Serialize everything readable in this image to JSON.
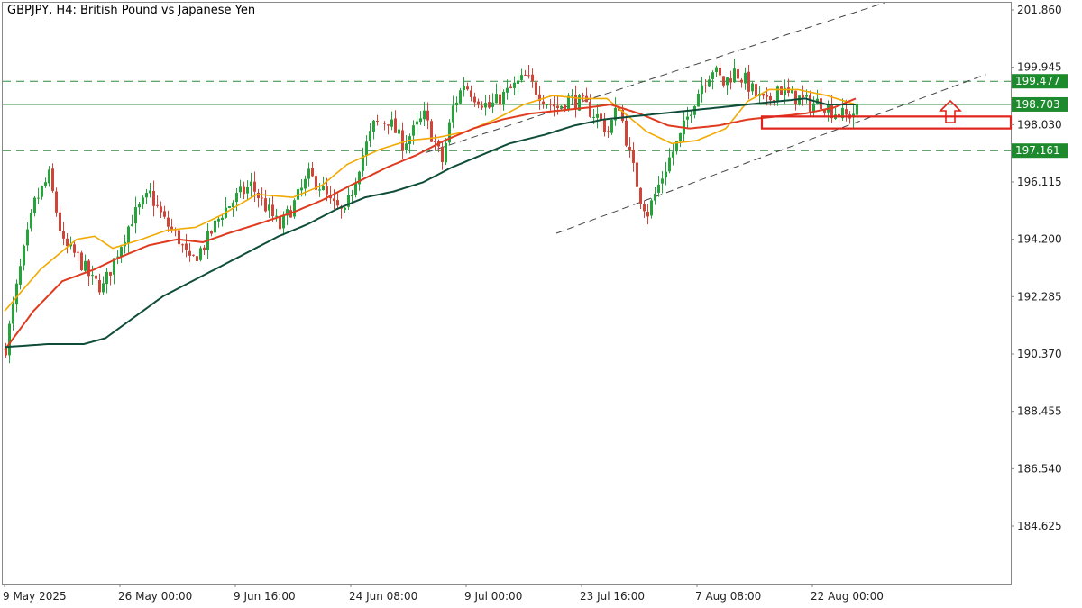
{
  "chart_title": "GBPJPY, H4:  British Pound vs Japanese Yen",
  "chart_data": {
    "type": "candlestick",
    "symbol": "GBPJPY",
    "timeframe": "H4",
    "title": "GBPJPY, H4:  British Pound vs Japanese Yen",
    "ylim": [
      182.7,
      202.1
    ],
    "y_ticks": [
      "201.860",
      "199.945",
      "198.030",
      "196.115",
      "194.200",
      "192.285",
      "190.370",
      "188.455",
      "186.540",
      "184.625"
    ],
    "x_ticks": [
      "9 May 2025",
      "26 May 00:00",
      "9 Jun 16:00",
      "24 Jun 08:00",
      "9 Jul 00:00",
      "23 Jul 16:00",
      "7 Aug 08:00",
      "22 Aug 00:00"
    ],
    "price_tags": [
      {
        "label": "199.477",
        "value": 199.477,
        "color": "#1e8a2e"
      },
      {
        "label": "198.703",
        "value": 198.703,
        "color": "#1e8a2e"
      },
      {
        "label": "197.161",
        "value": 197.161,
        "color": "#1e8a2e"
      }
    ],
    "close_path": [
      [
        0,
        190.6
      ],
      [
        4,
        193.2
      ],
      [
        8,
        195.4
      ],
      [
        12,
        196.3
      ],
      [
        16,
        194.0
      ],
      [
        20,
        193.6
      ],
      [
        24,
        192.8
      ],
      [
        27,
        192.6
      ],
      [
        31,
        193.8
      ],
      [
        35,
        194.9
      ],
      [
        40,
        195.7
      ],
      [
        44,
        194.8
      ],
      [
        48,
        194.2
      ],
      [
        51,
        193.4
      ],
      [
        55,
        194.0
      ],
      [
        60,
        195.1
      ],
      [
        64,
        195.6
      ],
      [
        68,
        196.0
      ],
      [
        72,
        195.3
      ],
      [
        76,
        194.6
      ],
      [
        80,
        195.4
      ],
      [
        84,
        196.3
      ],
      [
        87,
        196.0
      ],
      [
        90,
        195.4
      ],
      [
        94,
        195.0
      ],
      [
        98,
        196.7
      ],
      [
        102,
        198.0
      ],
      [
        106,
        198.2
      ],
      [
        110,
        197.4
      ],
      [
        113,
        197.8
      ],
      [
        116,
        198.3
      ],
      [
        119,
        197.4
      ],
      [
        121,
        196.8
      ],
      [
        124,
        198.6
      ],
      [
        127,
        199.4
      ],
      [
        130,
        199.0
      ],
      [
        134,
        198.6
      ],
      [
        138,
        199.0
      ],
      [
        141,
        199.3
      ],
      [
        144,
        199.6
      ],
      [
        147,
        199.2
      ],
      [
        150,
        198.8
      ],
      [
        153,
        198.6
      ],
      [
        156,
        198.9
      ],
      [
        160,
        198.7
      ],
      [
        164,
        198.3
      ],
      [
        167,
        197.8
      ],
      [
        170,
        198.7
      ],
      [
        173,
        197.0
      ],
      [
        176,
        195.6
      ],
      [
        178,
        195.1
      ],
      [
        181,
        196.0
      ],
      [
        184,
        196.9
      ],
      [
        187,
        197.6
      ],
      [
        190,
        198.6
      ],
      [
        193,
        199.4
      ],
      [
        196,
        199.9
      ],
      [
        199,
        199.4
      ],
      [
        202,
        199.8
      ],
      [
        205,
        199.5
      ],
      [
        208,
        199.0
      ],
      [
        211,
        198.7
      ],
      [
        214,
        199.3
      ],
      [
        217,
        199.0
      ],
      [
        220,
        198.9
      ],
      [
        223,
        198.7
      ],
      [
        226,
        198.8
      ],
      [
        229,
        198.5
      ],
      [
        233,
        198.3
      ],
      [
        236,
        198.5
      ]
    ],
    "moving_averages": [
      {
        "color": "#f2a900",
        "points": [
          [
            0,
            191.8
          ],
          [
            10,
            193.2
          ],
          [
            20,
            194.2
          ],
          [
            25,
            194.3
          ],
          [
            30,
            193.9
          ],
          [
            38,
            194.2
          ],
          [
            45,
            194.5
          ],
          [
            53,
            194.6
          ],
          [
            60,
            195.0
          ],
          [
            70,
            195.7
          ],
          [
            80,
            195.6
          ],
          [
            88,
            196.0
          ],
          [
            95,
            196.7
          ],
          [
            104,
            197.2
          ],
          [
            112,
            197.5
          ],
          [
            120,
            197.6
          ],
          [
            128,
            197.8
          ],
          [
            136,
            198.2
          ],
          [
            144,
            198.7
          ],
          [
            152,
            199.0
          ],
          [
            160,
            198.9
          ],
          [
            167,
            198.9
          ],
          [
            172,
            198.4
          ],
          [
            178,
            197.8
          ],
          [
            185,
            197.4
          ],
          [
            192,
            197.5
          ],
          [
            200,
            197.9
          ],
          [
            206,
            198.8
          ],
          [
            212,
            199.2
          ],
          [
            220,
            199.2
          ],
          [
            228,
            199.0
          ],
          [
            236,
            198.7
          ]
        ]
      },
      {
        "color": "#e03a1f",
        "points": [
          [
            0,
            190.5
          ],
          [
            8,
            191.8
          ],
          [
            16,
            192.8
          ],
          [
            25,
            193.2
          ],
          [
            32,
            193.6
          ],
          [
            40,
            194.0
          ],
          [
            48,
            194.2
          ],
          [
            55,
            194.1
          ],
          [
            62,
            194.4
          ],
          [
            70,
            194.7
          ],
          [
            80,
            195.1
          ],
          [
            88,
            195.5
          ],
          [
            96,
            196.0
          ],
          [
            106,
            196.6
          ],
          [
            114,
            197.0
          ],
          [
            122,
            197.5
          ],
          [
            130,
            197.9
          ],
          [
            138,
            198.2
          ],
          [
            146,
            198.4
          ],
          [
            154,
            198.5
          ],
          [
            162,
            198.6
          ],
          [
            168,
            198.7
          ],
          [
            176,
            198.4
          ],
          [
            184,
            198.0
          ],
          [
            190,
            197.9
          ],
          [
            198,
            198.0
          ],
          [
            206,
            198.2
          ],
          [
            214,
            198.3
          ],
          [
            222,
            198.4
          ],
          [
            230,
            198.6
          ],
          [
            236,
            198.9
          ]
        ]
      },
      {
        "color": "#0f4d3a",
        "points": [
          [
            0,
            190.6
          ],
          [
            12,
            190.7
          ],
          [
            22,
            190.7
          ],
          [
            28,
            190.9
          ],
          [
            36,
            191.6
          ],
          [
            44,
            192.3
          ],
          [
            52,
            192.8
          ],
          [
            60,
            193.3
          ],
          [
            68,
            193.8
          ],
          [
            76,
            194.3
          ],
          [
            84,
            194.7
          ],
          [
            92,
            195.2
          ],
          [
            100,
            195.6
          ],
          [
            108,
            195.8
          ],
          [
            116,
            196.1
          ],
          [
            124,
            196.6
          ],
          [
            132,
            197.0
          ],
          [
            140,
            197.4
          ],
          [
            150,
            197.7
          ],
          [
            158,
            198.0
          ],
          [
            166,
            198.2
          ],
          [
            174,
            198.3
          ],
          [
            182,
            198.4
          ],
          [
            190,
            198.5
          ],
          [
            198,
            198.6
          ],
          [
            206,
            198.7
          ],
          [
            214,
            198.8
          ],
          [
            222,
            198.9
          ],
          [
            228,
            198.7
          ],
          [
            236,
            198.7
          ]
        ]
      }
    ],
    "channel": {
      "upper": [
        [
          117,
          197.1
        ],
        [
          244,
          202.1
        ]
      ],
      "lower": [
        [
          153,
          194.4
        ],
        [
          272,
          199.7
        ]
      ]
    },
    "zone": {
      "top": 198.3,
      "bottom": 197.9,
      "start_bar": 210
    }
  }
}
